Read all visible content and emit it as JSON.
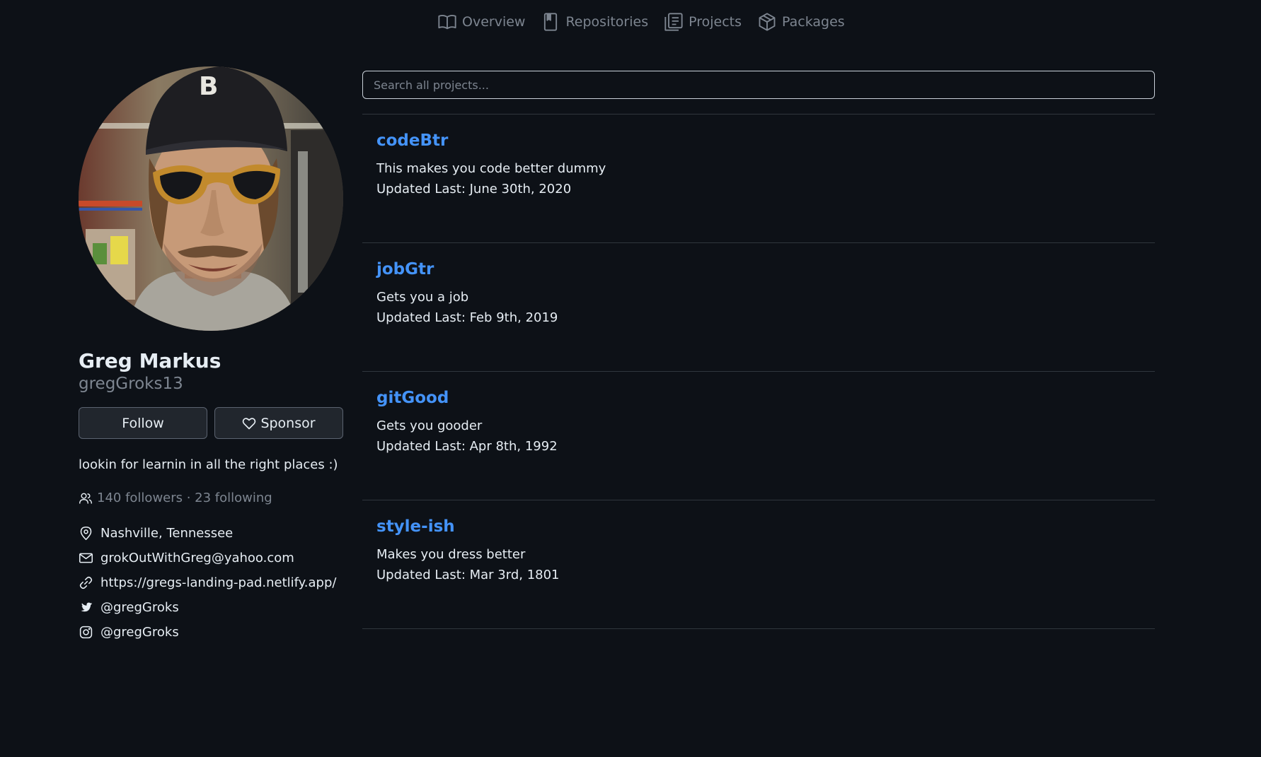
{
  "nav": {
    "tabs": [
      {
        "label": "Overview",
        "icon": "book-icon"
      },
      {
        "label": "Repositories",
        "icon": "repo-icon"
      },
      {
        "label": "Projects",
        "icon": "project-icon"
      },
      {
        "label": "Packages",
        "icon": "package-icon"
      }
    ]
  },
  "profile": {
    "name": "Greg Markus",
    "login": "gregGroks13",
    "follow_label": "Follow",
    "sponsor_label": "Sponsor",
    "bio": "lookin for learnin in all the right places :)",
    "followers_text": "140 followers · 23 following",
    "location": "Nashville, Tennessee",
    "email": "grokOutWithGreg@yahoo.com",
    "website": "https://gregs-landing-pad.netlify.app/",
    "twitter": "@gregGroks",
    "instagram": "@gregGroks"
  },
  "search": {
    "placeholder": "Search all projects..."
  },
  "projects": [
    {
      "name": "codeBtr",
      "description": "This makes you code better dummy",
      "updated": "Updated Last: June 30th, 2020"
    },
    {
      "name": "jobGtr",
      "description": "Gets you a job",
      "updated": "Updated Last: Feb 9th, 2019"
    },
    {
      "name": "gitGood",
      "description": "Gets you gooder",
      "updated": "Updated Last: Apr 8th, 1992"
    },
    {
      "name": "style-ish",
      "description": "Makes you dress better",
      "updated": "Updated Last: Mar 3rd, 1801"
    }
  ],
  "colors": {
    "background": "#0d1117",
    "link": "#4493f8",
    "muted": "#7d8590",
    "border": "#30363d"
  }
}
